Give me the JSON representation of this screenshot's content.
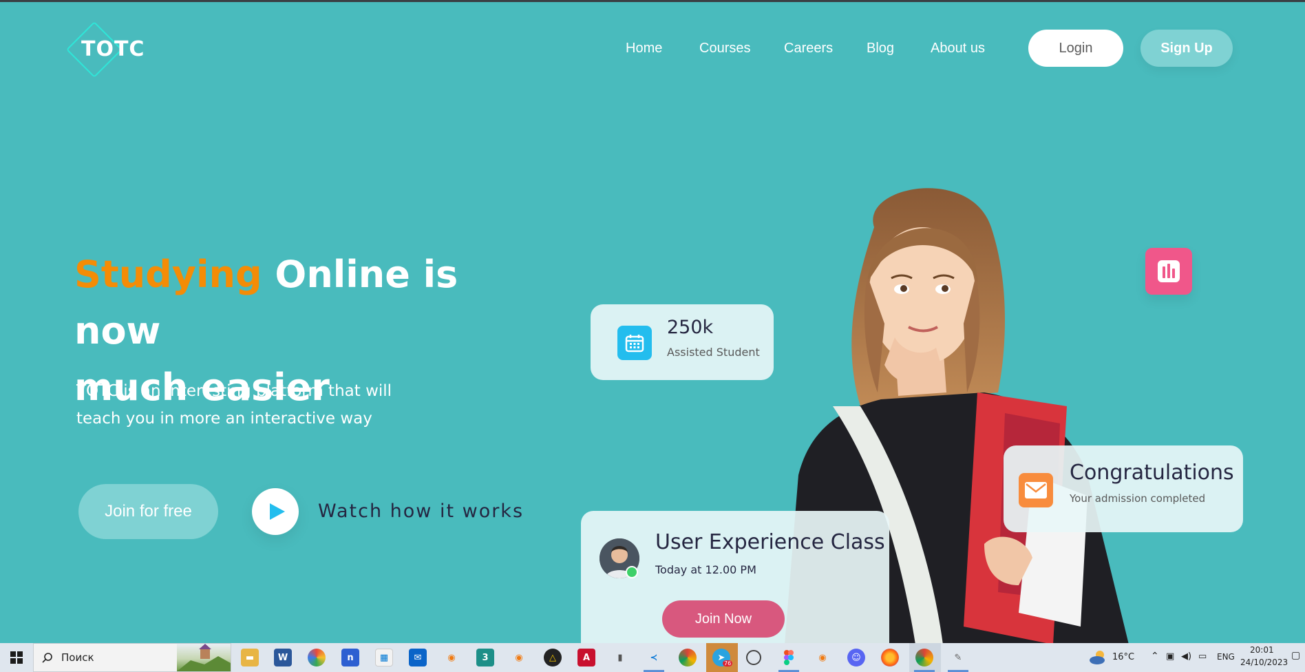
{
  "header": {
    "logo_text": "TOTC",
    "nav": [
      "Home",
      "Courses",
      "Careers",
      "Blog",
      "About us"
    ],
    "login_label": "Login",
    "signup_label": "Sign Up"
  },
  "hero": {
    "title_accent": "Studying",
    "title_rest_line1": " Online is now",
    "title_line2": "much easier",
    "subtitle_line1": "TOTC is an interesting platform that will",
    "subtitle_line2": "teach you in more an interactive way",
    "join_label": "Join for free",
    "watch_label": "Watch how it works"
  },
  "cards": {
    "students": {
      "value": "250k",
      "label": "Assisted Student"
    },
    "congrats": {
      "title": "Congratulations",
      "subtitle": "Your admission completed"
    },
    "class": {
      "title": "User Experience Class",
      "time": "Today at 12.00 PM",
      "join_label": "Join Now"
    }
  },
  "taskbar": {
    "search_placeholder": "Поиск",
    "weather": "16°C",
    "language": "ENG",
    "time": "20:01",
    "date": "24/10/2023",
    "telegram_badge": "76"
  },
  "colors": {
    "background": "#49BBBD",
    "accent": "#F48C06",
    "join_now": "#D8587E",
    "calendar_icon": "#23BDEE",
    "chart_icon": "#F0578A",
    "mail_icon": "#F88C3D"
  }
}
